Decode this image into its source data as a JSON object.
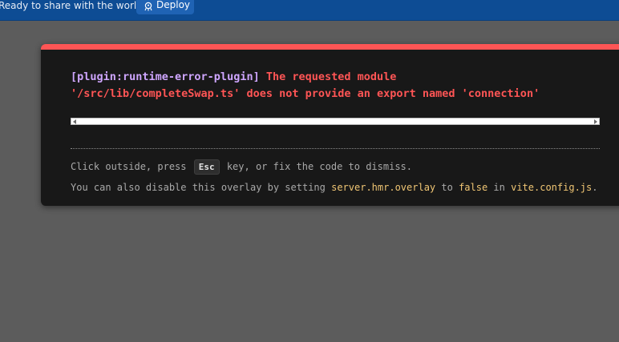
{
  "topbar": {
    "message": "Ready to share with the world?",
    "deploy_label": "Deploy",
    "deploy_icon": "rocket-icon"
  },
  "error": {
    "plugin": "[plugin:runtime-error-plugin]",
    "line1": " The requested module",
    "line2": "'/src/lib/completeSwap.ts' does not provide an export named 'connection'"
  },
  "tip": {
    "line1_prefix": "Click outside, press ",
    "esc_key": "Esc",
    "line1_suffix": " key, or fix the code to dismiss.",
    "line2_prefix": "You can also disable this overlay by setting ",
    "setting": "server.hmr.overlay",
    "line2_to": " to ",
    "value": "false",
    "line2_in": " in ",
    "file": "vite.config.js",
    "line2_end": "."
  },
  "colors": {
    "error": "#ff5555",
    "plugin": "#cfa6ff",
    "code": "#f0c674",
    "topbar": "#0d4c94"
  }
}
